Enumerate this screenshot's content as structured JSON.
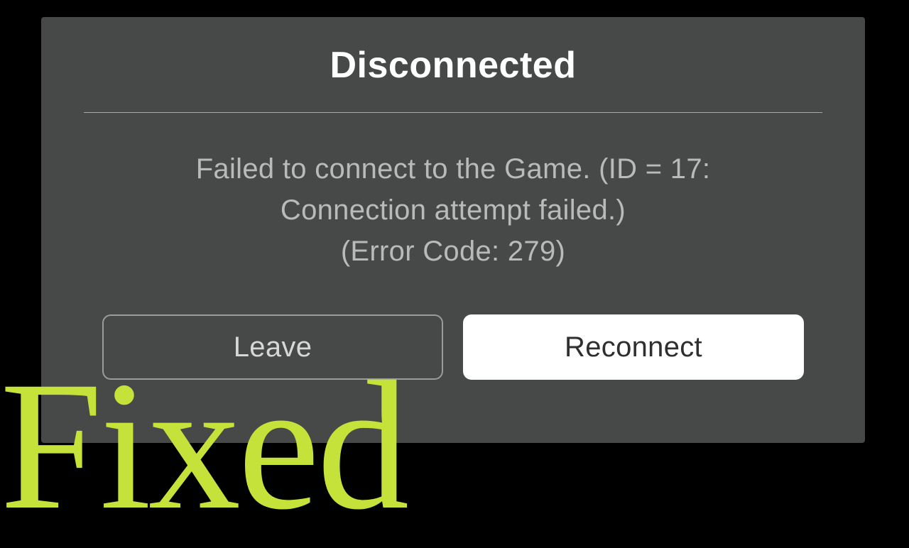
{
  "dialog": {
    "title": "Disconnected",
    "message": "Failed to connect to the Game. (ID = 17:\nConnection attempt failed.)\n(Error Code: 279)",
    "leave_label": "Leave",
    "reconnect_label": "Reconnect"
  },
  "overlay": {
    "text": "Fixed"
  }
}
